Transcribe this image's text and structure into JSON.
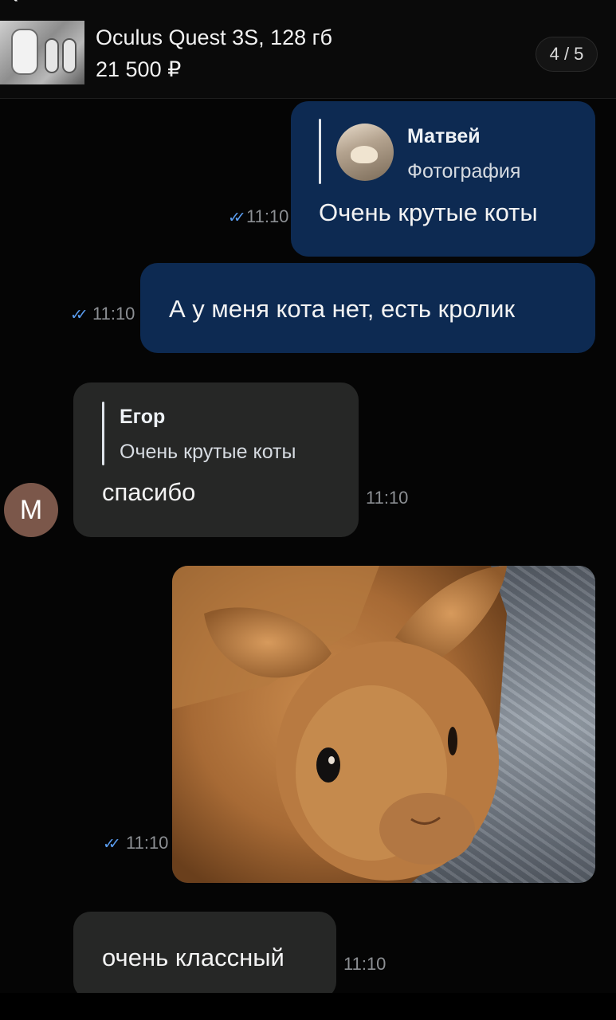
{
  "header": {
    "product_title": "Oculus Quest 3S, 128 гб",
    "product_price": "21 500 ₽",
    "page_counter": "4 / 5"
  },
  "messages": [
    {
      "direction": "outgoing",
      "reply": {
        "name": "Матвей",
        "text": "Фотография"
      },
      "text": "Очень крутые коты",
      "time": "11:10",
      "read": true
    },
    {
      "direction": "outgoing",
      "text": "А у меня кота нет, есть кролик",
      "time": "11:10",
      "read": true
    },
    {
      "direction": "incoming",
      "avatar_letter": "М",
      "reply": {
        "name": "Егор",
        "text": "Очень крутые коты"
      },
      "text": "спасибо",
      "time": "11:10"
    },
    {
      "direction": "outgoing",
      "type": "photo",
      "photo_subject": "rabbit-photo",
      "time": "11:10",
      "read": true
    },
    {
      "direction": "incoming",
      "text": "очень классный",
      "time": "11:10"
    }
  ],
  "colors": {
    "outgoing_bubble": "#0d2a52",
    "incoming_bubble": "#262726",
    "read_ticks": "#5a9df0",
    "avatar_bg": "#7b574a"
  }
}
